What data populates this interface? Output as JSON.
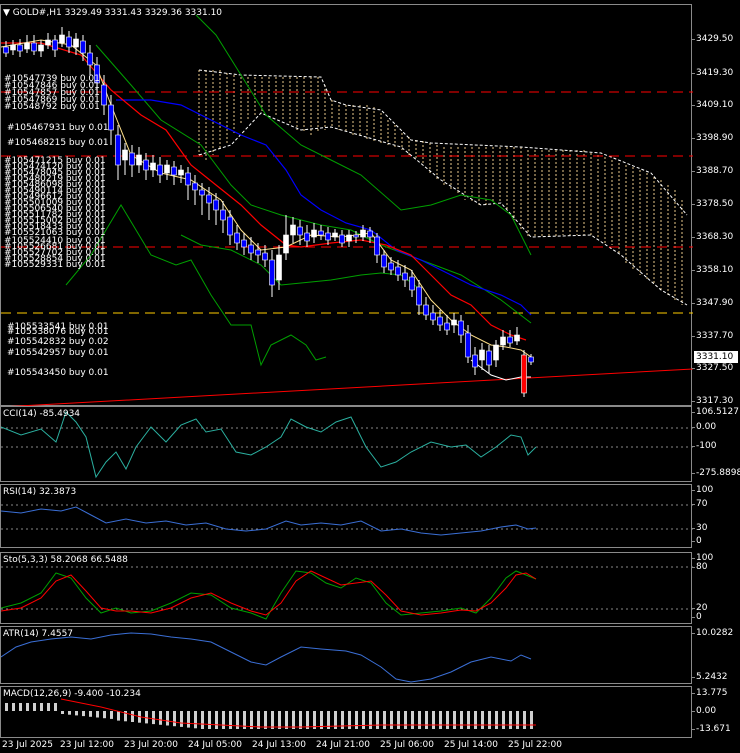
{
  "header": {
    "symbol_label": "GOLD#,H1",
    "ohlc": "3329.49 3331.43 3329.36 3331.10"
  },
  "main_axis": {
    "ticks": [
      "3429.50",
      "3419.30",
      "3409.10",
      "3398.90",
      "3388.70",
      "3378.50",
      "3368.30",
      "3358.10",
      "3347.90",
      "3337.70",
      "3327.50",
      "3317.30"
    ],
    "current_price": "3331.10"
  },
  "orders_upper": [
    "#105467931 buy 0.01",
    "#105468215 buy 0.01"
  ],
  "orders_lower": [
    "#105533541 buy 0.01",
    "#105538076 buy 0.01",
    "#105542832 buy 0.02",
    "#105542957 buy 0.01",
    "#105543450 buy 0.01"
  ],
  "cci": {
    "label": "CCI(14) -85.4934",
    "ticks": [
      "106.5127",
      "0.00",
      "-100",
      "-275.8898"
    ]
  },
  "rsi": {
    "label": "RSI(14) 32.3873",
    "ticks": [
      "100",
      "70",
      "30",
      "0"
    ]
  },
  "stoch": {
    "label": "Sto(5,3,3) 58.2068 66.5488",
    "ticks": [
      "100",
      "80",
      "20",
      "0"
    ]
  },
  "atr": {
    "label": "ATR(14) 7.4557",
    "ticks": [
      "10.0282",
      "5.2432"
    ]
  },
  "macd": {
    "label": "MACD(12,26,9) -9.400 -10.234",
    "ticks": [
      "13.775",
      "0.00",
      "-13.671"
    ]
  },
  "time_axis": {
    "labels": [
      "23 Jul 2025",
      "23 Jul 12:00",
      "23 Jul 20:00",
      "24 Jul 05:00",
      "24 Jul 13:00",
      "24 Jul 21:00",
      "25 Jul 06:00",
      "25 Jul 14:00",
      "25 Jul 22:00"
    ]
  },
  "colors": {
    "bull": "#ffffff",
    "bear": "#0000ff",
    "ma_red": "#ff0000",
    "ma_blue": "#0000ff",
    "ma_green": "#00a000",
    "ichimoku": "#ffd68a",
    "level_red": "#ff0000",
    "level_yellow": "#ffcc00",
    "indicator_line": "#3b6fd6",
    "cci_line": "#2bb0a0"
  }
}
